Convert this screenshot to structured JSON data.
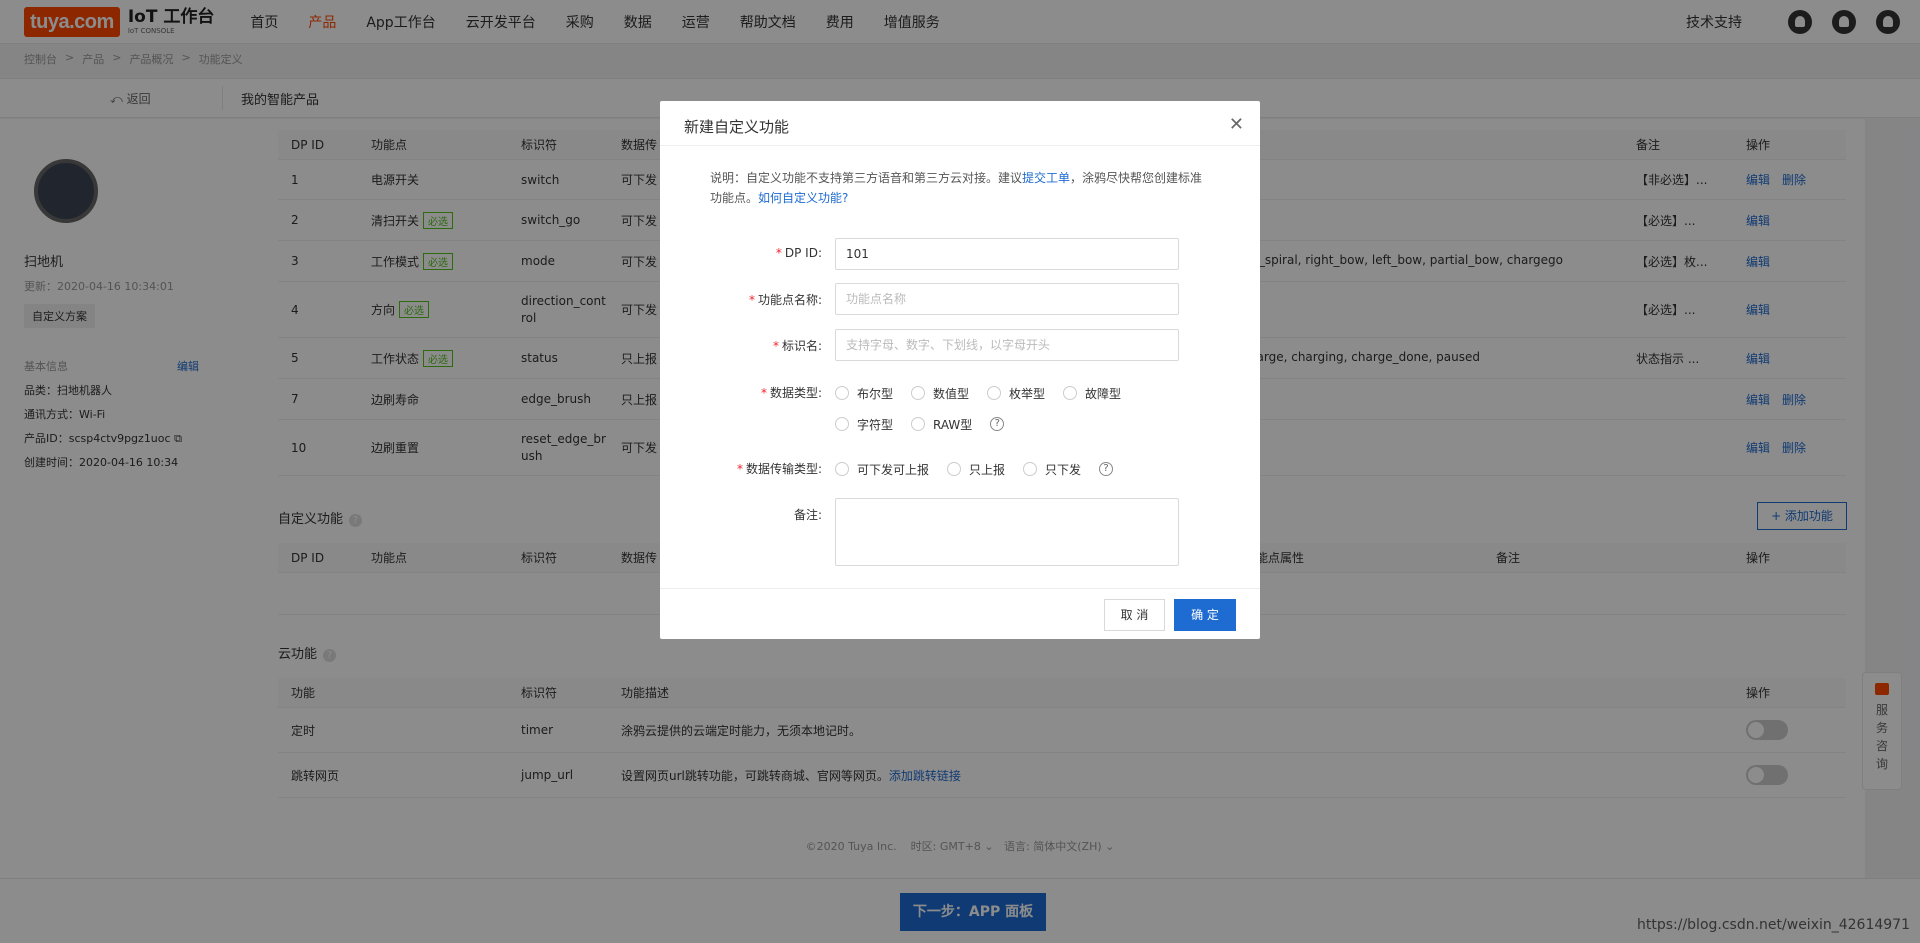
{
  "nav": {
    "logo_brand": "tuya.com",
    "logo_title": "IoT 工作台",
    "logo_sub": "IoT CONSOLE",
    "items": [
      "首页",
      "产品",
      "App工作台",
      "云开发平台",
      "采购",
      "数据",
      "运营",
      "帮助文档",
      "费用",
      "增值服务"
    ],
    "tech_support": "技术支持"
  },
  "breadcrumb": [
    "控制台",
    ">",
    "产品",
    ">",
    "产品概况",
    ">",
    "功能定义"
  ],
  "subhead": {
    "back": "返回",
    "title": "我的智能产品"
  },
  "device": {
    "name": "扫地机",
    "updated": "更新：2020-04-16 10:34:01",
    "custom_tag": "自定义方案",
    "basic_info": "基本信息",
    "edit": "编辑",
    "category": "品类：扫地机器人",
    "comm": "通讯方式：Wi-Fi",
    "product_id": "产品ID：scsp4ctv9pgz1uoc",
    "created": "创建时间：2020-04-16 10:34"
  },
  "std_table": {
    "headers": [
      "DP ID",
      "功能点",
      "标识符",
      "数据传",
      "备注",
      "操作"
    ],
    "rows": [
      {
        "id": "1",
        "name": "电源开关",
        "req": "",
        "code": "switch",
        "trans": "可下发",
        "extra": "",
        "note": "【非必选】...",
        "ops": [
          "编辑",
          "删除"
        ]
      },
      {
        "id": "2",
        "name": "清扫开关",
        "req": "必选",
        "code": "switch_go",
        "trans": "可下发",
        "extra": "",
        "note": "【必选】...",
        "ops": [
          "编辑"
        ]
      },
      {
        "id": "3",
        "name": "工作模式",
        "req": "必选",
        "code": "mode",
        "trans": "可下发",
        "extra": "ght_spiral, right_bow, left_bow, partial_bow, chargego",
        "note": "【必选】枚...",
        "ops": [
          "编辑"
        ]
      },
      {
        "id": "4",
        "name": "方向",
        "req": "必选",
        "code": "direction_control",
        "trans": "可下发",
        "extra": "",
        "note": "【必选】...",
        "ops": [
          "编辑"
        ]
      },
      {
        "id": "5",
        "name": "工作状态",
        "req": "必选",
        "code": "status",
        "trans": "只上报",
        "extra": "_charge, charging, charge_done, paused",
        "note": "状态指示 ...",
        "ops": [
          "编辑"
        ]
      },
      {
        "id": "7",
        "name": "边刷寿命",
        "req": "",
        "code": "edge_brush",
        "trans": "只上报",
        "extra": "",
        "note": "",
        "ops": [
          "编辑",
          "删除"
        ]
      },
      {
        "id": "10",
        "name": "边刷重置",
        "req": "",
        "code": "reset_edge_brush",
        "trans": "可下发",
        "extra": "",
        "note": "",
        "ops": [
          "编辑",
          "删除"
        ]
      }
    ]
  },
  "custom_section": {
    "title": "自定义功能",
    "add_button": "+ 添加功能",
    "headers": [
      "DP ID",
      "功能点",
      "标识符",
      "数据传",
      "能点属性",
      "备注",
      "操作"
    ]
  },
  "cloud_section": {
    "title": "云功能",
    "headers": [
      "功能",
      "标识符",
      "功能描述",
      "操作"
    ],
    "rows": [
      {
        "name": "定时",
        "code": "timer",
        "desc": "涂鸦云提供的云端定时能力，无须本地记时。",
        "link": ""
      },
      {
        "name": "跳转网页",
        "code": "jump_url",
        "desc": "设置网页url跳转功能，可跳转商城、官网等网页。",
        "link": "添加跳转链接"
      }
    ]
  },
  "footer": {
    "copyright": "©2020 Tuya Inc.",
    "tz_label": "时区:",
    "tz": "GMT+8",
    "lang_label": "语言:",
    "lang": "简体中文(ZH)"
  },
  "next_button": "下一步：APP 面板",
  "service": "服务咨询",
  "watermark": "https://blog.csdn.net/weixin_42614971",
  "modal": {
    "title": "新建自定义功能",
    "notice_1": "说明：自定义功能不支持第三方语音和第三方云对接。建议",
    "notice_link": "提交工单",
    "notice_2": "，涂鸦尽快帮您创建标准功能点。",
    "notice_link2": "如何自定义功能?",
    "dpid_label": "DP ID:",
    "dpid_value": "101",
    "name_label": "功能点名称:",
    "name_placeholder": "功能点名称",
    "code_label": "标识名:",
    "code_placeholder": "支持字母、数字、下划线，以字母开头",
    "dtype_label": "数据类型:",
    "dtypes": [
      "布尔型",
      "数值型",
      "枚举型",
      "故障型",
      "字符型",
      "RAW型"
    ],
    "trans_label": "数据传输类型:",
    "trans": [
      "可下发可上报",
      "只上报",
      "只下发"
    ],
    "note_label": "备注:",
    "cancel": "取 消",
    "ok": "确 定"
  }
}
